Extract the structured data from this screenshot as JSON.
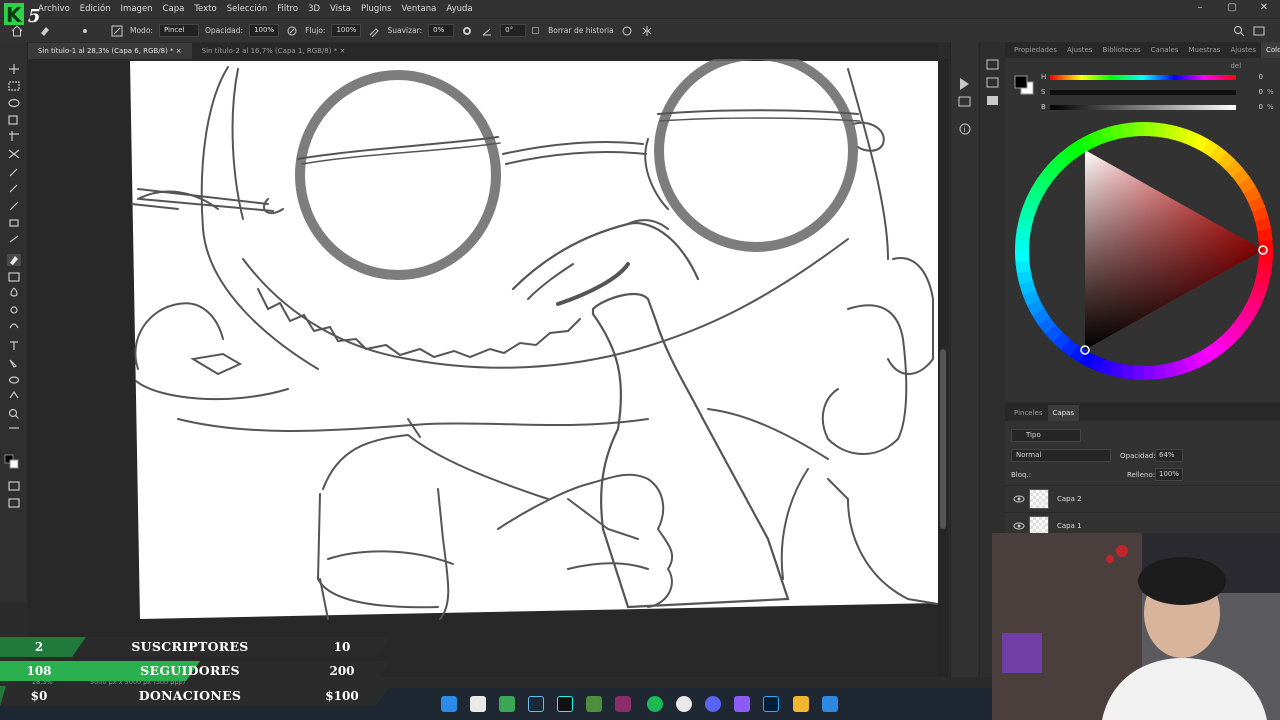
{
  "menubar": {
    "items": [
      "Archivo",
      "Edición",
      "Imagen",
      "Capa",
      "Texto",
      "Selección",
      "Filtro",
      "3D",
      "Vista",
      "Plugins",
      "Ventana",
      "Ayuda"
    ]
  },
  "options": {
    "mode_label": "Modo:",
    "mode_value": "Pincel",
    "opacity_label": "Opacidad:",
    "opacity_value": "100%",
    "flow_label": "Flujo:",
    "flow_value": "100%",
    "smooth_label": "Suavizar:",
    "smooth_value": "0%",
    "angle_value": "0°",
    "history_label": "Borrar de historia"
  },
  "tabs": [
    {
      "label": "Sin título-1 al 28,3% (Capa 6, RGB/8) *"
    },
    {
      "label": "Sin título-2 al 16,7% (Capa 1, RGB/8) *"
    }
  ],
  "right_panel": {
    "tabs": [
      "Propiedades",
      "Ajustes",
      "Bibliotecas",
      "Canales",
      "Muestras",
      "Ajustes del",
      "Color"
    ],
    "hsb": [
      {
        "label": "H",
        "value": "0",
        "unit": ""
      },
      {
        "label": "S",
        "value": "0",
        "unit": "%"
      },
      {
        "label": "B",
        "value": "0",
        "unit": "%"
      }
    ]
  },
  "layers_panel": {
    "tabs": [
      "Pinceles",
      "Capas"
    ],
    "filter_label": "Tipo",
    "blend_mode": "Normal",
    "opacity_label": "Opacidad:",
    "opacity_value": "64%",
    "lock_label": "Bloq.:",
    "fill_label": "Relleno:",
    "fill_value": "100%",
    "layers": [
      {
        "name": "Capa 2"
      },
      {
        "name": "Capa 1"
      }
    ]
  },
  "statusbar": {
    "zoom": "28,3%",
    "doc_info": "5000 px x 5000 px (300 ppp)"
  },
  "stream_overlay": {
    "rows": [
      {
        "left": "2",
        "label": "SUSCRIPTORES",
        "right": "10",
        "color": "#1f7a3c"
      },
      {
        "left": "108",
        "label": "SEGUIDORES",
        "right": "200",
        "color": "#2bb04f"
      },
      {
        "left": "$0",
        "label": "DONACIONES",
        "right": "$100",
        "color": "#1f7a3c"
      }
    ]
  },
  "colors": {
    "accent": "#31a8ff",
    "panel_bg": "#323232",
    "overlay_green": "#2bb04f"
  }
}
